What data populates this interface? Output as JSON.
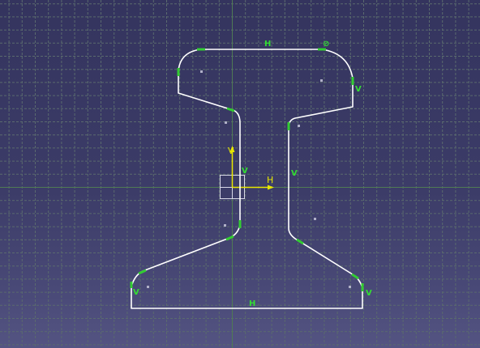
{
  "colors": {
    "background_top": "#34345e",
    "background_bottom": "#545482",
    "grid": "#5a6a6e",
    "axis_line": "#4f7a55",
    "profile": "#ffffff",
    "endpoint": "#33cc33",
    "constraint_label": "#33dd33",
    "sketch_axis": "#e6e600",
    "construction_point": "#b0b0c8"
  },
  "constraints": {
    "top_horizontal": "H",
    "top_tangency": "⊘",
    "top_right_vertical": "V",
    "web_left_vertical": "V",
    "web_right_vertical": "V",
    "bottom_left_vertical": "V",
    "bottom_horizontal": "H",
    "bottom_right_vertical": "V"
  },
  "sketch_axes": {
    "h_label": "H",
    "v_label": "V"
  }
}
